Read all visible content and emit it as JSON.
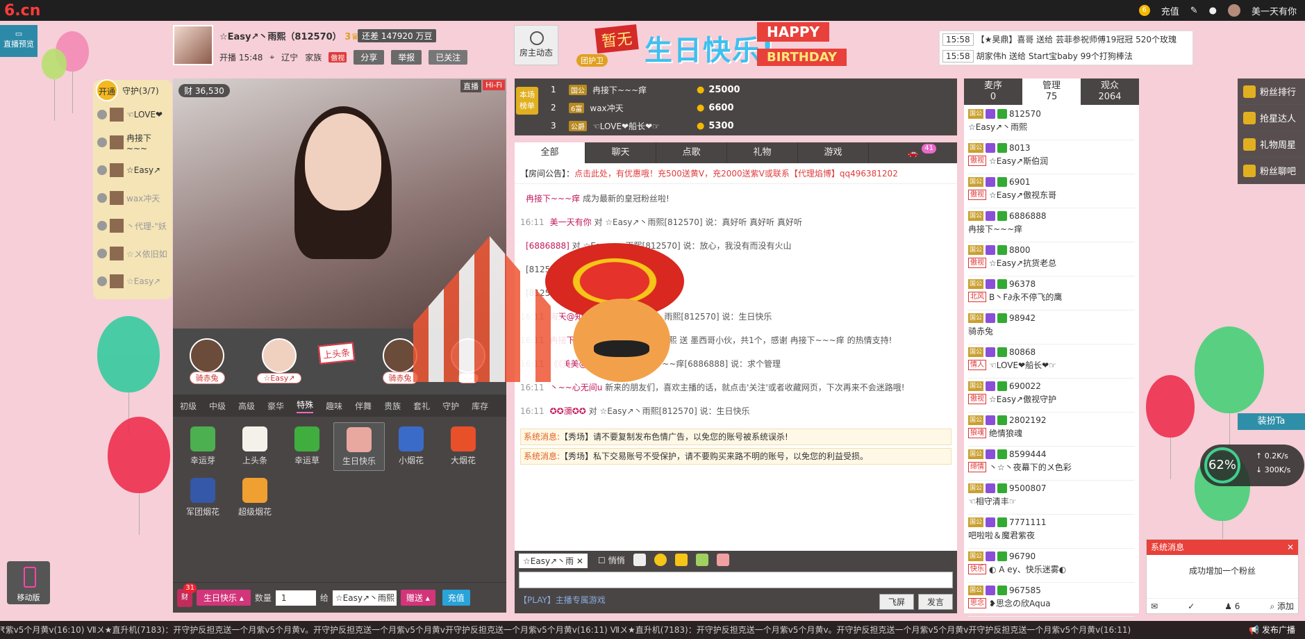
{
  "topbar": {
    "logo": "6.cn",
    "charge": "充值",
    "username": "美一天有你"
  },
  "preview_btn": "直播预览",
  "host": {
    "name": "☆Easy↗丶雨熙（812570）",
    "level": "3",
    "stats": "还差 147920 万豆",
    "time": "开播 15:48",
    "location": "辽宁",
    "family_label": "家族",
    "family_tag": "傲视",
    "share": "分享",
    "report": "举报",
    "followed": "已关注"
  },
  "fan_dynamic": "房主动态",
  "banner": {
    "none": "暂无",
    "text": "生日快乐!",
    "happy": "HAPPY",
    "birthday": "BIRTHDAY",
    "guard": "团护卫"
  },
  "notices": [
    {
      "time": "15:58",
      "text": "【★昊鼎】喜哥 送给 芸菲参祝师傅19冠冠 520个玫瑰"
    },
    {
      "time": "15:58",
      "text": "胡家伟h 送给 Start宝baby 99个打狗棒法"
    }
  ],
  "guards": {
    "open": "开通",
    "title": "守护(3/7)",
    "items": [
      {
        "name": "☜LOVE❤",
        "dim": false
      },
      {
        "name": "冉接下~~~",
        "dim": false
      },
      {
        "name": "☆Easy↗",
        "dim": false
      },
      {
        "name": "wax冲天",
        "dim": true
      },
      {
        "name": "丶代理-\"妖",
        "dim": true
      },
      {
        "name": "☆〤依旧如",
        "dim": true
      },
      {
        "name": "☆Easy↗",
        "dim": true
      }
    ]
  },
  "video": {
    "heat": "36,530",
    "live": "直播",
    "hifi": "Hi-Fi"
  },
  "seats": [
    {
      "name": "骑赤兔"
    },
    {
      "name": "☆Easy↗"
    },
    {
      "name": "骑赤兔"
    },
    {
      "name": "-.-"
    }
  ],
  "headline_btn": "上头条",
  "gift_tabs": [
    "初级",
    "中级",
    "高级",
    "豪华",
    "特殊",
    "趣味",
    "伴舞",
    "贵族",
    "套礼",
    "守护",
    "库存"
  ],
  "gift_tab_active": "特殊",
  "gifts": [
    {
      "name": "幸运芽",
      "color": "#4caf50"
    },
    {
      "name": "上头条",
      "color": "#f4f1ea"
    },
    {
      "name": "幸运草",
      "color": "#3fae3f"
    },
    {
      "name": "生日快乐",
      "color": "#e8a8a0",
      "selected": true
    },
    {
      "name": "小烟花",
      "color": "#3a6bc8"
    },
    {
      "name": "大烟花",
      "color": "#e8502a"
    },
    {
      "name": "军团烟花",
      "color": "#3558a8"
    },
    {
      "name": "超级烟花",
      "color": "#f0a030"
    }
  ],
  "send_bar": {
    "bag_count": "31",
    "bag_label": "财",
    "gift": "生日快乐",
    "qty_label": "数量",
    "qty": "1",
    "to_label": "给",
    "to": "☆Easy↗丶雨熙",
    "send": "赠送",
    "charge": "充值"
  },
  "rank": {
    "label": "本场榜单",
    "rows": [
      {
        "no": "1",
        "name": "冉接下~~~痒",
        "amount": "25000"
      },
      {
        "no": "2",
        "name": "wax冲天",
        "amount": "6600"
      },
      {
        "no": "3",
        "name": "☜LOVE❤船长❤☞",
        "amount": "5300"
      }
    ]
  },
  "chat": {
    "tabs": [
      "全部",
      "聊天",
      "点歌",
      "礼物",
      "游戏"
    ],
    "car_count": "41",
    "announce_label": "【房间公告】：",
    "announce": "点击此处，有优惠哦！充500送黄V，充2000送紫V或联系【代理焰博】qq496381202",
    "messages": [
      {
        "time": "",
        "user": "冉接下~~~痒",
        "text": "成为最新的皇冠粉丝啦!"
      },
      {
        "time": "16:11",
        "user": "美一天有你",
        "text": "对 ☆Easy↗丶雨熙[812570] 说：真好听 真好听 真好听"
      },
      {
        "time": "",
        "user": "[6886888]",
        "text": "对 ☆Easy↗丶雨熙[812570] 说：放心，我没有而没有火山"
      },
      {
        "time": "",
        "user": "",
        "text": "[812570] 说：生日快乐"
      },
      {
        "time": "",
        "user": "",
        "text": "[812570] 说：乐"
      },
      {
        "time": "16:11",
        "user": "海天@知足常歌",
        "text": "对 ☆Easy↗丶雨熙[812570] 说：生日快乐"
      },
      {
        "time": "16:11",
        "user": "冉接下~~~痒",
        "text": "向 ☆Easy↗丶雨熙 送 墨西哥小伙，共1个，感谢 冉接下~~~痒 的热情支持!"
      },
      {
        "time": "16:11",
        "user": "《《美美@天真》》",
        "text": "对 冉接下~~~痒[6886888] 说：求个管理"
      },
      {
        "time": "16:11",
        "user": "丶~~心无间u",
        "text": "新来的朋友们，喜欢主播的话，就点击'关注'或者收藏网页，下次再来不会迷路哦!"
      },
      {
        "time": "16:11",
        "user": "✪✪瀰✪✪",
        "text": "对 ☆Easy↗丶雨熙[812570] 说：生日快乐"
      }
    ],
    "system": [
      {
        "label": "系统消息:",
        "text": "【秀场】请不要复制发布色情广告，以免您的账号被系统误杀!"
      },
      {
        "label": "系统消息:",
        "text": "【秀场】私下交易账号不受保护，请不要购买来路不明的账号，以免您的利益受损。"
      }
    ],
    "to": "☆Easy↗丶雨",
    "whisper": "悄悄",
    "play_hint": "【PLAY】主播专属游戏",
    "fly_btn": "飞屏",
    "send_btn": "发言"
  },
  "users": {
    "tabs": [
      {
        "label": "麦序",
        "count": "0"
      },
      {
        "label": "管理",
        "count": "75"
      },
      {
        "label": "观众",
        "count": "2064"
      }
    ],
    "list": [
      {
        "id": "812570",
        "name": "☆Easy↗丶雨熙",
        "role": ""
      },
      {
        "id": "8013",
        "name": "☆Easy↗斯伯润",
        "role": "傲视"
      },
      {
        "id": "6901",
        "name": "☆Easy↗傲视东哥",
        "role": "傲视"
      },
      {
        "id": "6886888",
        "name": "冉接下~~~痒",
        "role": ""
      },
      {
        "id": "8800",
        "name": "☆Easy↗抗货老总",
        "role": "傲视"
      },
      {
        "id": "96378",
        "name": "B丶F∂永不停飞的鹰",
        "role": "北风"
      },
      {
        "id": "98942",
        "name": "骑赤兔",
        "role": ""
      },
      {
        "id": "80868",
        "name": "☜LOVE❤船长❤☞",
        "role": "情人"
      },
      {
        "id": "690022",
        "name": "☆Easy↗傲视守护",
        "role": "傲视"
      },
      {
        "id": "2802192",
        "name": "绝情狼魂",
        "role": "狼魂"
      },
      {
        "id": "8599444",
        "name": "丶☆丶夜幕下的〤色彩",
        "role": "缔情"
      },
      {
        "id": "9500807",
        "name": "☜相守清丰☞",
        "role": ""
      },
      {
        "id": "7771111",
        "name": "吧啦啦＆魔君紫夜",
        "role": ""
      },
      {
        "id": "96790",
        "name": "◐ A ey、快乐迷雾◐",
        "role": "快乐"
      },
      {
        "id": "967585",
        "name": "❥思念の欣Aqua",
        "role": "思念"
      }
    ]
  },
  "side": [
    "粉丝排行",
    "抢星达人",
    "礼物周星",
    "粉丝聊吧"
  ],
  "dress_btn": "装扮Ta",
  "speed": {
    "pct": "62",
    "up": "0.2K/s",
    "down": "300K/s"
  },
  "sysbox": {
    "title": "系统消息",
    "text": "成功增加一个粉丝",
    "count": "6",
    "add": "添加"
  },
  "mobile": "移动版",
  "ticker": {
    "text": "₹紫v5个月黄v(16:10)  Ⅶ〤★直升机(7183)：开守护反担克送一个月紫v5个月黄v。开守护反担克送一个月紫v5个月黄v开守护反担克送一个月紫v5个月黄v(16:11)  Ⅶ〤★直升机(7183)：开守护反担克送一个月紫v5个月黄v。开守护反担克送一个月紫v5个月黄v开守护反担克送一个月紫v5个月黄v(16:11)",
    "broadcast": "发布广播"
  }
}
